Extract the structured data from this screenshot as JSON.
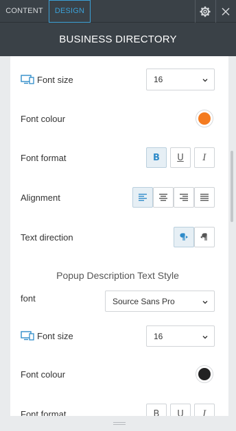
{
  "tabs": {
    "content": "CONTENT",
    "design": "DESIGN"
  },
  "header": {
    "title": "BUSINESS DIRECTORY"
  },
  "colors": {
    "accent": "#3aa1d8",
    "orange": "#f47b20",
    "dark_swatch": "#222222"
  },
  "text_style": {
    "font_size_label": "Font size",
    "font_size_value": "16",
    "font_colour_label": "Font colour",
    "font_format_label": "Font format",
    "alignment_label": "Alignment",
    "text_direction_label": "Text direction"
  },
  "popup": {
    "section_title": "Popup Description Text Style",
    "font_label": "font",
    "font_value": "Source Sans Pro",
    "font_size_label": "Font size",
    "font_size_value": "16",
    "font_colour_label": "Font colour",
    "font_format_label": "Font format"
  },
  "format_buttons": {
    "bold": "B",
    "underline": "U",
    "italic": "I"
  }
}
